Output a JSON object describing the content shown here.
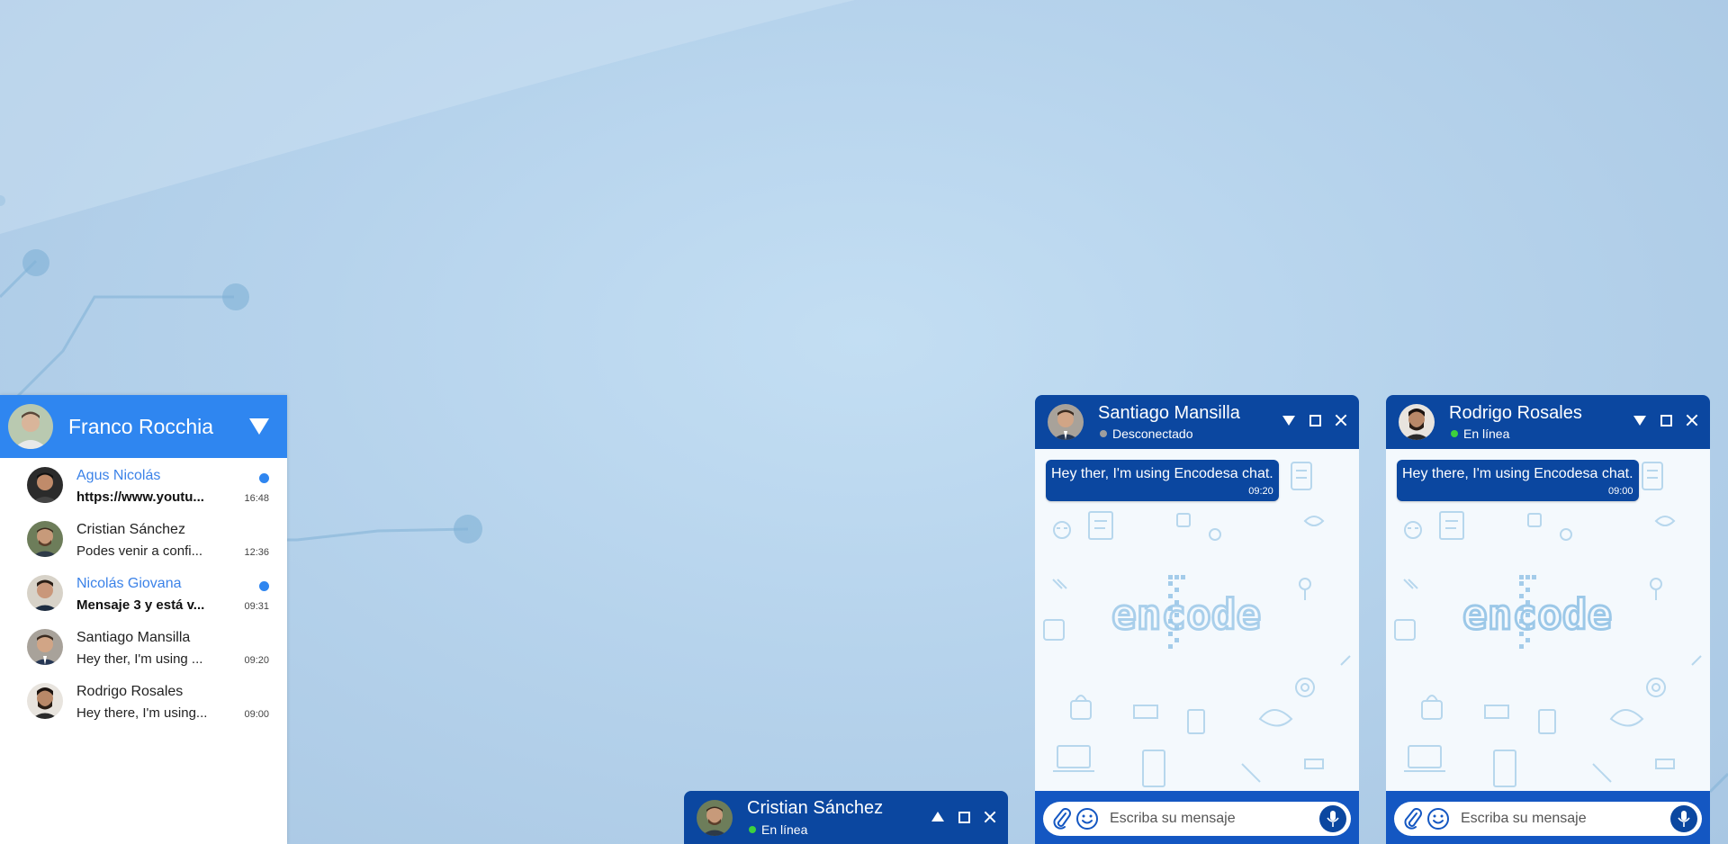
{
  "colors": {
    "primary_blue": "#2f86f0",
    "dark_blue": "#0b47a0",
    "footer_blue": "#1457c2",
    "online": "#3dd13d",
    "offline": "#9e9e9e",
    "unread_dot": "#2f86f0"
  },
  "contacts_panel": {
    "owner_name": "Franco Rocchia",
    "collapse_icon": "triangle-down-icon",
    "contacts": [
      {
        "name": "Agus Nicolás",
        "last_message": "https://www.youtu...",
        "time": "16:48",
        "unread": true
      },
      {
        "name": "Cristian Sánchez",
        "last_message": "Podes venir a confi...",
        "time": "12:36",
        "unread": false
      },
      {
        "name": "Nicolás Giovana",
        "last_message": "Mensaje 3 y está v...",
        "time": "09:31",
        "unread": true
      },
      {
        "name": "Santiago Mansilla",
        "last_message": "Hey ther, I'm using ...",
        "time": "09:20",
        "unread": false
      },
      {
        "name": "Rodrigo Rosales",
        "last_message": "Hey there, I'm using...",
        "time": "09:00",
        "unread": false
      }
    ]
  },
  "minimized_chat": {
    "name": "Cristian Sánchez",
    "status": "En línea"
  },
  "chat_windows": [
    {
      "name": "Santiago Mansilla",
      "status": "Desconectado",
      "message": {
        "text": "Hey ther, I'm using Encodesa chat.",
        "time": "09:20"
      },
      "input_placeholder": "Escriba su mensaje"
    },
    {
      "name": "Rodrigo Rosales",
      "status": "En línea",
      "message": {
        "text": "Hey there, I'm using Encodesa chat.",
        "time": "09:00"
      },
      "input_placeholder": "Escriba su mensaje"
    }
  ],
  "watermark": "encode"
}
